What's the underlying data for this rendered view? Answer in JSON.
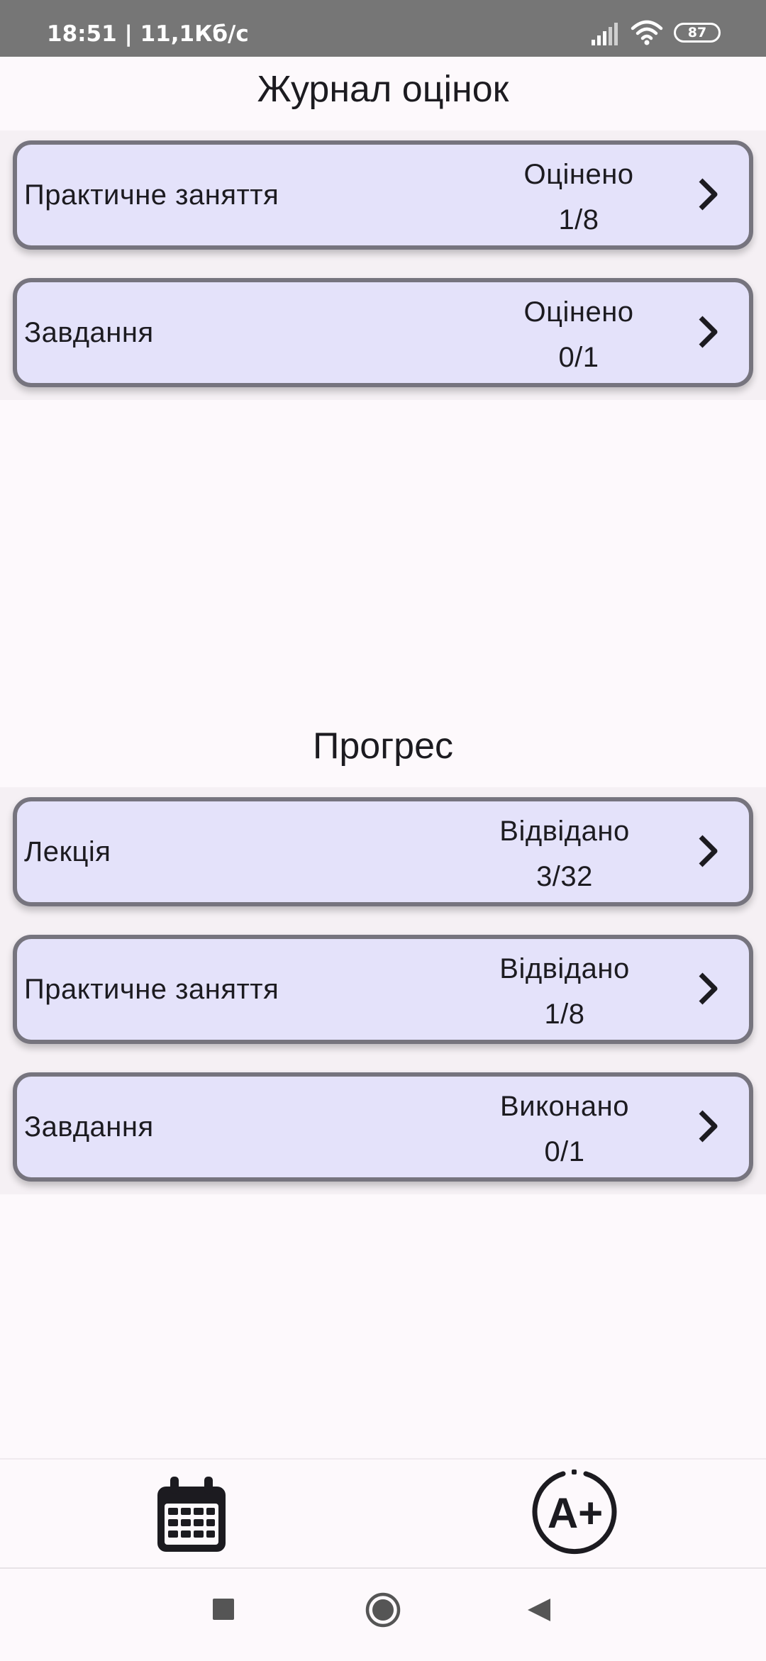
{
  "status_bar": {
    "time_speed": "18:51 | 11,1Кб/с",
    "battery": "87"
  },
  "grades": {
    "title": "Журнал оцінок",
    "items": [
      {
        "label": "Практичне заняття",
        "status": "Оцінено",
        "count": "1/8"
      },
      {
        "label": "Завдання",
        "status": "Оцінено",
        "count": "0/1"
      }
    ]
  },
  "progress": {
    "title": "Прогрес",
    "items": [
      {
        "label": "Лекція",
        "status": "Відвідано",
        "count": "3/32"
      },
      {
        "label": "Практичне заняття",
        "status": "Відвідано",
        "count": "1/8"
      },
      {
        "label": "Завдання",
        "status": "Виконано",
        "count": "0/1"
      }
    ]
  },
  "bottom_nav": {
    "items": [
      {
        "icon": "calendar-icon"
      },
      {
        "icon": "grade-a-plus-icon"
      }
    ]
  },
  "system_nav": {
    "icons": [
      "recents-square-icon",
      "home-circle-icon",
      "back-triangle-icon"
    ]
  },
  "colors": {
    "card_bg": "#e4e2fa",
    "card_border": "#76747e",
    "status_bar": "#767676",
    "background": "#fdf9fc"
  }
}
